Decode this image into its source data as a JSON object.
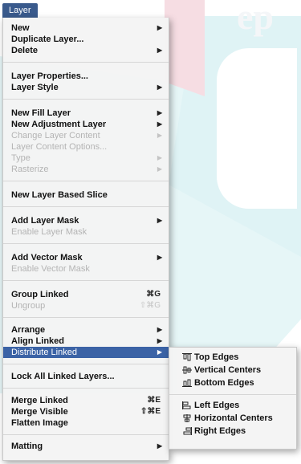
{
  "menubar": {
    "title": "Layer"
  },
  "background": {
    "text": "ep"
  },
  "menu": {
    "items": [
      {
        "label": "New",
        "arrow": "▶",
        "shortcut": "",
        "enabled": true
      },
      {
        "label": "Duplicate Layer...",
        "arrow": "",
        "shortcut": "",
        "enabled": true
      },
      {
        "label": "Delete",
        "arrow": "▶",
        "shortcut": "",
        "enabled": true
      },
      {
        "label": "Layer Properties...",
        "arrow": "",
        "shortcut": "",
        "enabled": true
      },
      {
        "label": "Layer Style",
        "arrow": "▶",
        "shortcut": "",
        "enabled": true
      },
      {
        "label": "New Fill Layer",
        "arrow": "▶",
        "shortcut": "",
        "enabled": true
      },
      {
        "label": "New Adjustment Layer",
        "arrow": "▶",
        "shortcut": "",
        "enabled": true
      },
      {
        "label": "Change Layer Content",
        "arrow": "▶",
        "shortcut": "",
        "enabled": false
      },
      {
        "label": "Layer Content Options...",
        "arrow": "",
        "shortcut": "",
        "enabled": false
      },
      {
        "label": "Type",
        "arrow": "▶",
        "shortcut": "",
        "enabled": false
      },
      {
        "label": "Rasterize",
        "arrow": "▶",
        "shortcut": "",
        "enabled": false
      },
      {
        "label": "New Layer Based Slice",
        "arrow": "",
        "shortcut": "",
        "enabled": true
      },
      {
        "label": "Add Layer Mask",
        "arrow": "▶",
        "shortcut": "",
        "enabled": true
      },
      {
        "label": "Enable Layer Mask",
        "arrow": "",
        "shortcut": "",
        "enabled": false
      },
      {
        "label": "Add Vector Mask",
        "arrow": "▶",
        "shortcut": "",
        "enabled": true
      },
      {
        "label": "Enable Vector Mask",
        "arrow": "",
        "shortcut": "",
        "enabled": false
      },
      {
        "label": "Group Linked",
        "arrow": "",
        "shortcut": "⌘G",
        "enabled": true
      },
      {
        "label": "Ungroup",
        "arrow": "",
        "shortcut": "⇧⌘G",
        "enabled": false
      },
      {
        "label": "Arrange",
        "arrow": "▶",
        "shortcut": "",
        "enabled": true
      },
      {
        "label": "Align Linked",
        "arrow": "▶",
        "shortcut": "",
        "enabled": true
      },
      {
        "label": "Distribute Linked",
        "arrow": "▶",
        "shortcut": "",
        "enabled": true,
        "active": true
      },
      {
        "label": "Lock All Linked Layers...",
        "arrow": "",
        "shortcut": "",
        "enabled": true
      },
      {
        "label": "Merge Linked",
        "arrow": "",
        "shortcut": "⌘E",
        "enabled": true
      },
      {
        "label": "Merge Visible",
        "arrow": "",
        "shortcut": "⇧⌘E",
        "enabled": true
      },
      {
        "label": "Flatten Image",
        "arrow": "",
        "shortcut": "",
        "enabled": true
      },
      {
        "label": "Matting",
        "arrow": "▶",
        "shortcut": "",
        "enabled": true
      }
    ]
  },
  "submenu": {
    "items": [
      {
        "label": "Top Edges",
        "icon": "distribute-top-edges-icon"
      },
      {
        "label": "Vertical Centers",
        "icon": "distribute-vertical-centers-icon"
      },
      {
        "label": "Bottom Edges",
        "icon": "distribute-bottom-edges-icon"
      },
      {
        "label": "Left Edges",
        "icon": "distribute-left-edges-icon"
      },
      {
        "label": "Horizontal Centers",
        "icon": "distribute-horizontal-centers-icon"
      },
      {
        "label": "Right Edges",
        "icon": "distribute-right-edges-icon"
      }
    ]
  },
  "colors": {
    "highlight": "#3b63a6",
    "menubar_tab": "#3a5a8c",
    "disabled_text": "#b4b4b4"
  }
}
